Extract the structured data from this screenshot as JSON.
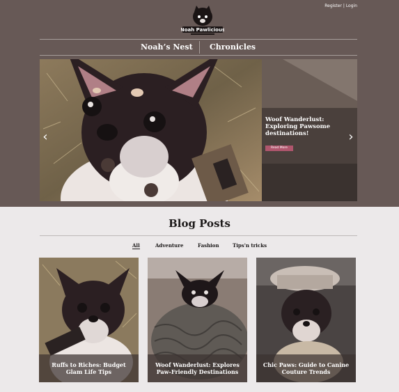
{
  "header": {
    "register_label": "Register",
    "separator": "|",
    "login_label": "Login",
    "logo_text": "Noah Pawlicious"
  },
  "nav": {
    "items": [
      {
        "label": "Noah’s Nest"
      },
      {
        "label": "Chronicles"
      }
    ]
  },
  "hero": {
    "title": "Woof Wanderlust: Exploring Pawsome  destinations!",
    "read_more_label": "Read More",
    "prev_icon": "chevron-left-icon",
    "next_icon": "chevron-right-icon"
  },
  "blog": {
    "title": "Blog Posts",
    "filters": [
      {
        "label": "All",
        "active": true
      },
      {
        "label": "Adventure",
        "active": false
      },
      {
        "label": "Fashion",
        "active": false
      },
      {
        "label": "Tips'n tricks",
        "active": false
      }
    ],
    "posts": [
      {
        "title": "Ruffs to Riches: Budget Glam Life Tips"
      },
      {
        "title": "Woof Wanderlust: Explores Paw-Friendly Destinations"
      },
      {
        "title": "Chic Paws: Guide to Canine Couture Trends"
      }
    ]
  },
  "colors": {
    "header_bg": "#675956",
    "page_bg": "#ece9ea",
    "accent": "#b0566d"
  }
}
